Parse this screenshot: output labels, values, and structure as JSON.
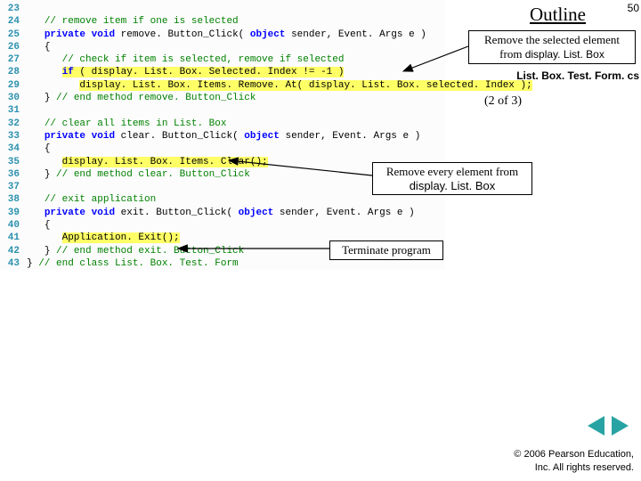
{
  "slide": {
    "outline": "Outline",
    "number": "50",
    "file": "List. Box. Test. Form. cs",
    "pager": "(2 of 3)"
  },
  "callouts": {
    "c1l1": "Remove the selected element",
    "c1l2pre": "from ",
    "c1l2code": "display. List. Box",
    "c2l1": "Remove every element from",
    "c2l2": "display. List. Box",
    "c3": "Terminate program"
  },
  "code": {
    "l23": "",
    "l24_cmt": "// remove item if one is selected",
    "l25_kw1": "private",
    "l25_kw2": "void",
    "l25_mid": " remove. Button_Click( ",
    "l25_kw3": "object",
    "l25_mid2": " sender, Event. Args e )",
    "l26": "{",
    "l27_cmt": "// check if item is selected, remove if selected",
    "l28_a": "if",
    "l28_b": " ( display. List. Box. Selected. Index != ",
    "l28_c": "-1",
    "l28_d": " )",
    "l29": "display. List. Box. Items. Remove. At( display. List. Box. selected. Index );",
    "l30_a": "} ",
    "l30_b": "// end method remove. Button_Click",
    "l31": "",
    "l32_cmt": "// clear all items in List. Box",
    "l33_kw1": "private",
    "l33_kw2": "void",
    "l33_mid": " clear. Button_Click( ",
    "l33_kw3": "object",
    "l33_mid2": " sender, Event. Args e )",
    "l34": "{",
    "l35": "display. List. Box. Items. Clear();",
    "l36_a": "} ",
    "l36_b": "// end method clear. Button_Click",
    "l37": "",
    "l38_cmt": "// exit application",
    "l39_kw1": "private",
    "l39_kw2": "void",
    "l39_mid": " exit. Button_Click( ",
    "l39_kw3": "object",
    "l39_mid2": " sender, Event. Args e )",
    "l40": "{",
    "l41": "Application. Exit();",
    "l42_a": "} ",
    "l42_b": "// end method exit. Button_Click",
    "l43_a": "} ",
    "l43_b": "// end class List. Box. Test. Form"
  },
  "footer": {
    "copy1": "© 2006 Pearson Education,",
    "copy2": "Inc.  All rights reserved."
  }
}
